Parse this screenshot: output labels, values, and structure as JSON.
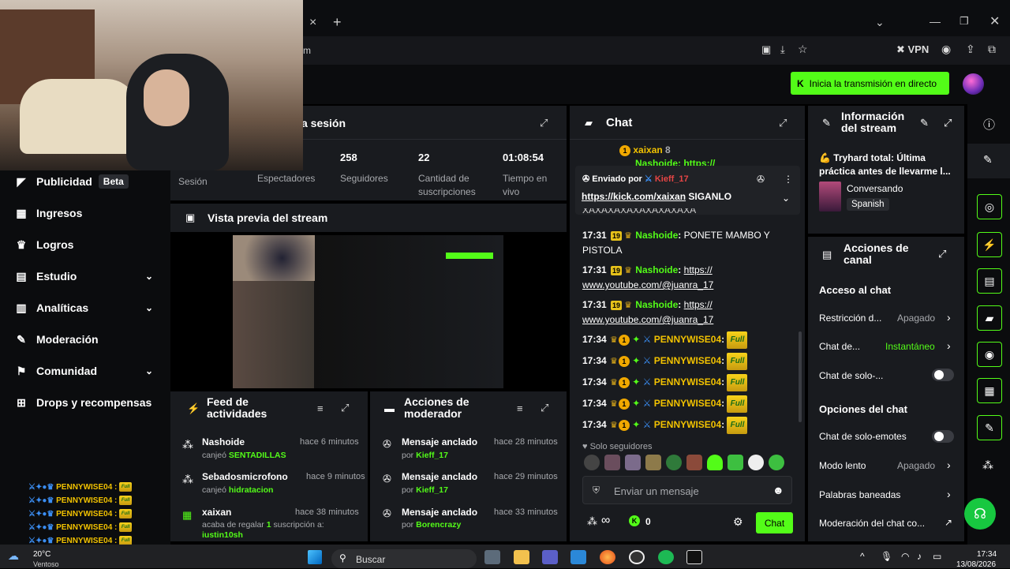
{
  "browser": {
    "address_fragment": "m",
    "vpn_label": "VPN",
    "newtab": "+",
    "close": "×"
  },
  "topbar": {
    "go_live": "Inicia la transmisión en directo"
  },
  "sidebar": {
    "items": [
      {
        "label": "Publicidad",
        "badge": "Beta",
        "icon": "megaphone-icon"
      },
      {
        "label": "Ingresos",
        "icon": "money-icon"
      },
      {
        "label": "Logros",
        "icon": "trophy-icon"
      },
      {
        "label": "Estudio",
        "icon": "studio-icon",
        "chevron": "⌄"
      },
      {
        "label": "Analíticas",
        "icon": "chart-icon",
        "chevron": "⌄"
      },
      {
        "label": "Moderación",
        "icon": "wrench-icon"
      },
      {
        "label": "Comunidad",
        "icon": "community-icon",
        "chevron": "⌄"
      },
      {
        "label": "Drops y recompensas",
        "icon": "gift-icon"
      }
    ]
  },
  "session": {
    "title": "a sesión",
    "stats": [
      {
        "value": "",
        "label": "Sesión"
      },
      {
        "value": "",
        "label": "Espectadores"
      },
      {
        "value": "258",
        "label": "Seguidores"
      },
      {
        "value": "22",
        "label": "Cantidad de suscripciones"
      },
      {
        "value": "01:08:54",
        "label": "Tiempo en vivo"
      }
    ]
  },
  "preview": {
    "title": "Vista previa del stream"
  },
  "feed": {
    "title": "Feed de actividades",
    "rows": [
      {
        "name": "Nashoide",
        "time": "hace 6 minutos",
        "action": "canjeó",
        "target": "SENTADILLAS"
      },
      {
        "name": "Sebadosmicrofono",
        "time": "hace 9 minutos",
        "action": "canjeó",
        "target": "hidratacion"
      },
      {
        "name": "xaixan",
        "time": "hace 38 minutos",
        "action": "acaba de regalar",
        "count": "1",
        "target": "suscripción a:",
        "extra": "iustin10sh"
      }
    ]
  },
  "modactions": {
    "title": "Acciones de moderador",
    "rows": [
      {
        "name": "Mensaje anclado",
        "time": "hace 28 minutos",
        "by": "por",
        "user": "Kieff_17"
      },
      {
        "name": "Mensaje anclado",
        "time": "hace 29 minutos",
        "by": "por",
        "user": "Kieff_17"
      },
      {
        "name": "Mensaje anclado",
        "time": "hace 33 minutos",
        "by": "por",
        "user": "Borencrazy"
      }
    ]
  },
  "chat": {
    "title": "Chat",
    "top_user": "xaixan",
    "top_count": "8",
    "top_partial": "Nashoide: https://",
    "pinned": {
      "sent_by": "Enviado por",
      "user": "Kieff_17",
      "link": "https://kick.com/xaixan",
      "text": " SIGANLO"
    },
    "hidden_text": "XAXAXAXAXAXAXAXAXA",
    "messages": [
      {
        "time": "17:31",
        "months": "19",
        "user": "Nashoide",
        "text": "PONETE MAMBO Y PISTOLA"
      },
      {
        "time": "17:31",
        "months": "19",
        "user": "Nashoide",
        "text": "https:// www.youtube.com/@juanra_17"
      },
      {
        "time": "17:31",
        "months": "19",
        "user": "Nashoide",
        "text": "https:// www.youtube.com/@juanra_17"
      }
    ],
    "emote_rows": [
      {
        "time": "17:34",
        "user": "PENNYWISE04",
        "emote": "Full"
      },
      {
        "time": "17:34",
        "user": "PENNYWISE04",
        "emote": "Full"
      },
      {
        "time": "17:34",
        "user": "PENNYWISE04",
        "emote": "Full"
      },
      {
        "time": "17:34",
        "user": "PENNYWISE04",
        "emote": "Full"
      },
      {
        "time": "17:34",
        "user": "PENNYWISE04",
        "emote": "Full"
      }
    ],
    "followers_only": "Solo seguidores",
    "placeholder": "Enviar un mensaje",
    "points": "0",
    "send": "Chat",
    "infinity": "∞"
  },
  "stream_info": {
    "title": "Información del stream",
    "stream_title": "💪 Tryhard total: Última práctica antes de llevarme l...",
    "category": "Conversando",
    "language": "Spanish"
  },
  "channel_actions": {
    "title": "Acciones de canal",
    "chat_access": "Acceso al chat",
    "rows": [
      {
        "label": "Restricción d...",
        "value": "Apagado"
      },
      {
        "label": "Chat de...",
        "value": "Instantáneo"
      },
      {
        "label": "Chat de solo-...",
        "value": ""
      }
    ],
    "chat_options": "Opciones del chat",
    "rows2": [
      {
        "label": "Chat de solo-emotes",
        "value": ""
      },
      {
        "label": "Modo lento",
        "value": "Apagado"
      },
      {
        "label": "Palabras baneadas",
        "value": ""
      },
      {
        "label": "Moderación del chat co...",
        "value": ""
      }
    ]
  },
  "overlay_chat": [
    {
      "user": "PENNYWISE04 :",
      "emote": "Full"
    },
    {
      "user": "PENNYWISE04 :",
      "emote": "Full"
    },
    {
      "user": "PENNYWISE04 :",
      "emote": "Full"
    },
    {
      "user": "PENNYWISE04 :",
      "emote": "Full"
    },
    {
      "user": "PENNYWISE04 :",
      "emote": "Full"
    }
  ],
  "taskbar": {
    "temp": "20°C",
    "weather": "Ventoso",
    "search": "Buscar",
    "time": "17:34",
    "date": "13/08/2026",
    "lang": "^"
  }
}
